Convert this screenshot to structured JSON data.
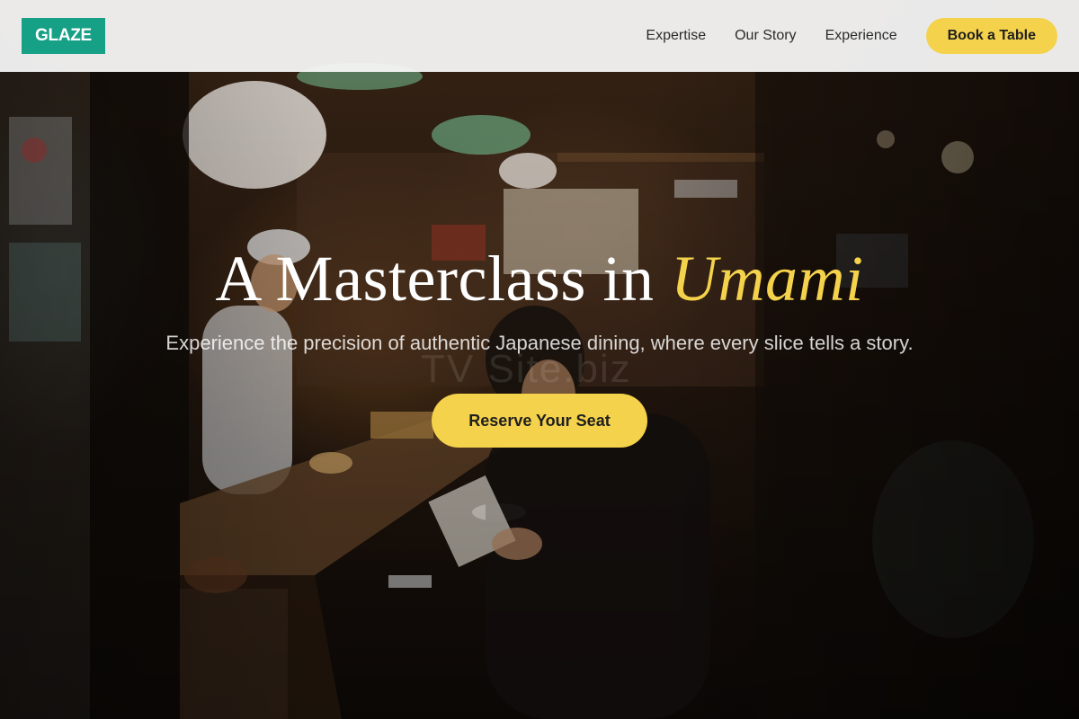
{
  "header": {
    "logo_text": "GLAZE",
    "nav": [
      {
        "label": "Expertise"
      },
      {
        "label": "Our Story"
      },
      {
        "label": "Experience"
      }
    ],
    "cta_label": "Book a Table"
  },
  "hero": {
    "title_main": "A Masterclass in",
    "title_accent": "Umami",
    "subtitle": "Experience the precision of authentic Japanese dining, where every slice tells a story.",
    "cta_label": "Reserve Your Seat",
    "watermark": "TV Site.biz",
    "background_description": "izakaya-counter-scene"
  },
  "colors": {
    "logo_bg": "#16a085",
    "accent": "#f5d24b",
    "header_bg": "#fafafa",
    "text_dark": "#2b2b2b"
  }
}
